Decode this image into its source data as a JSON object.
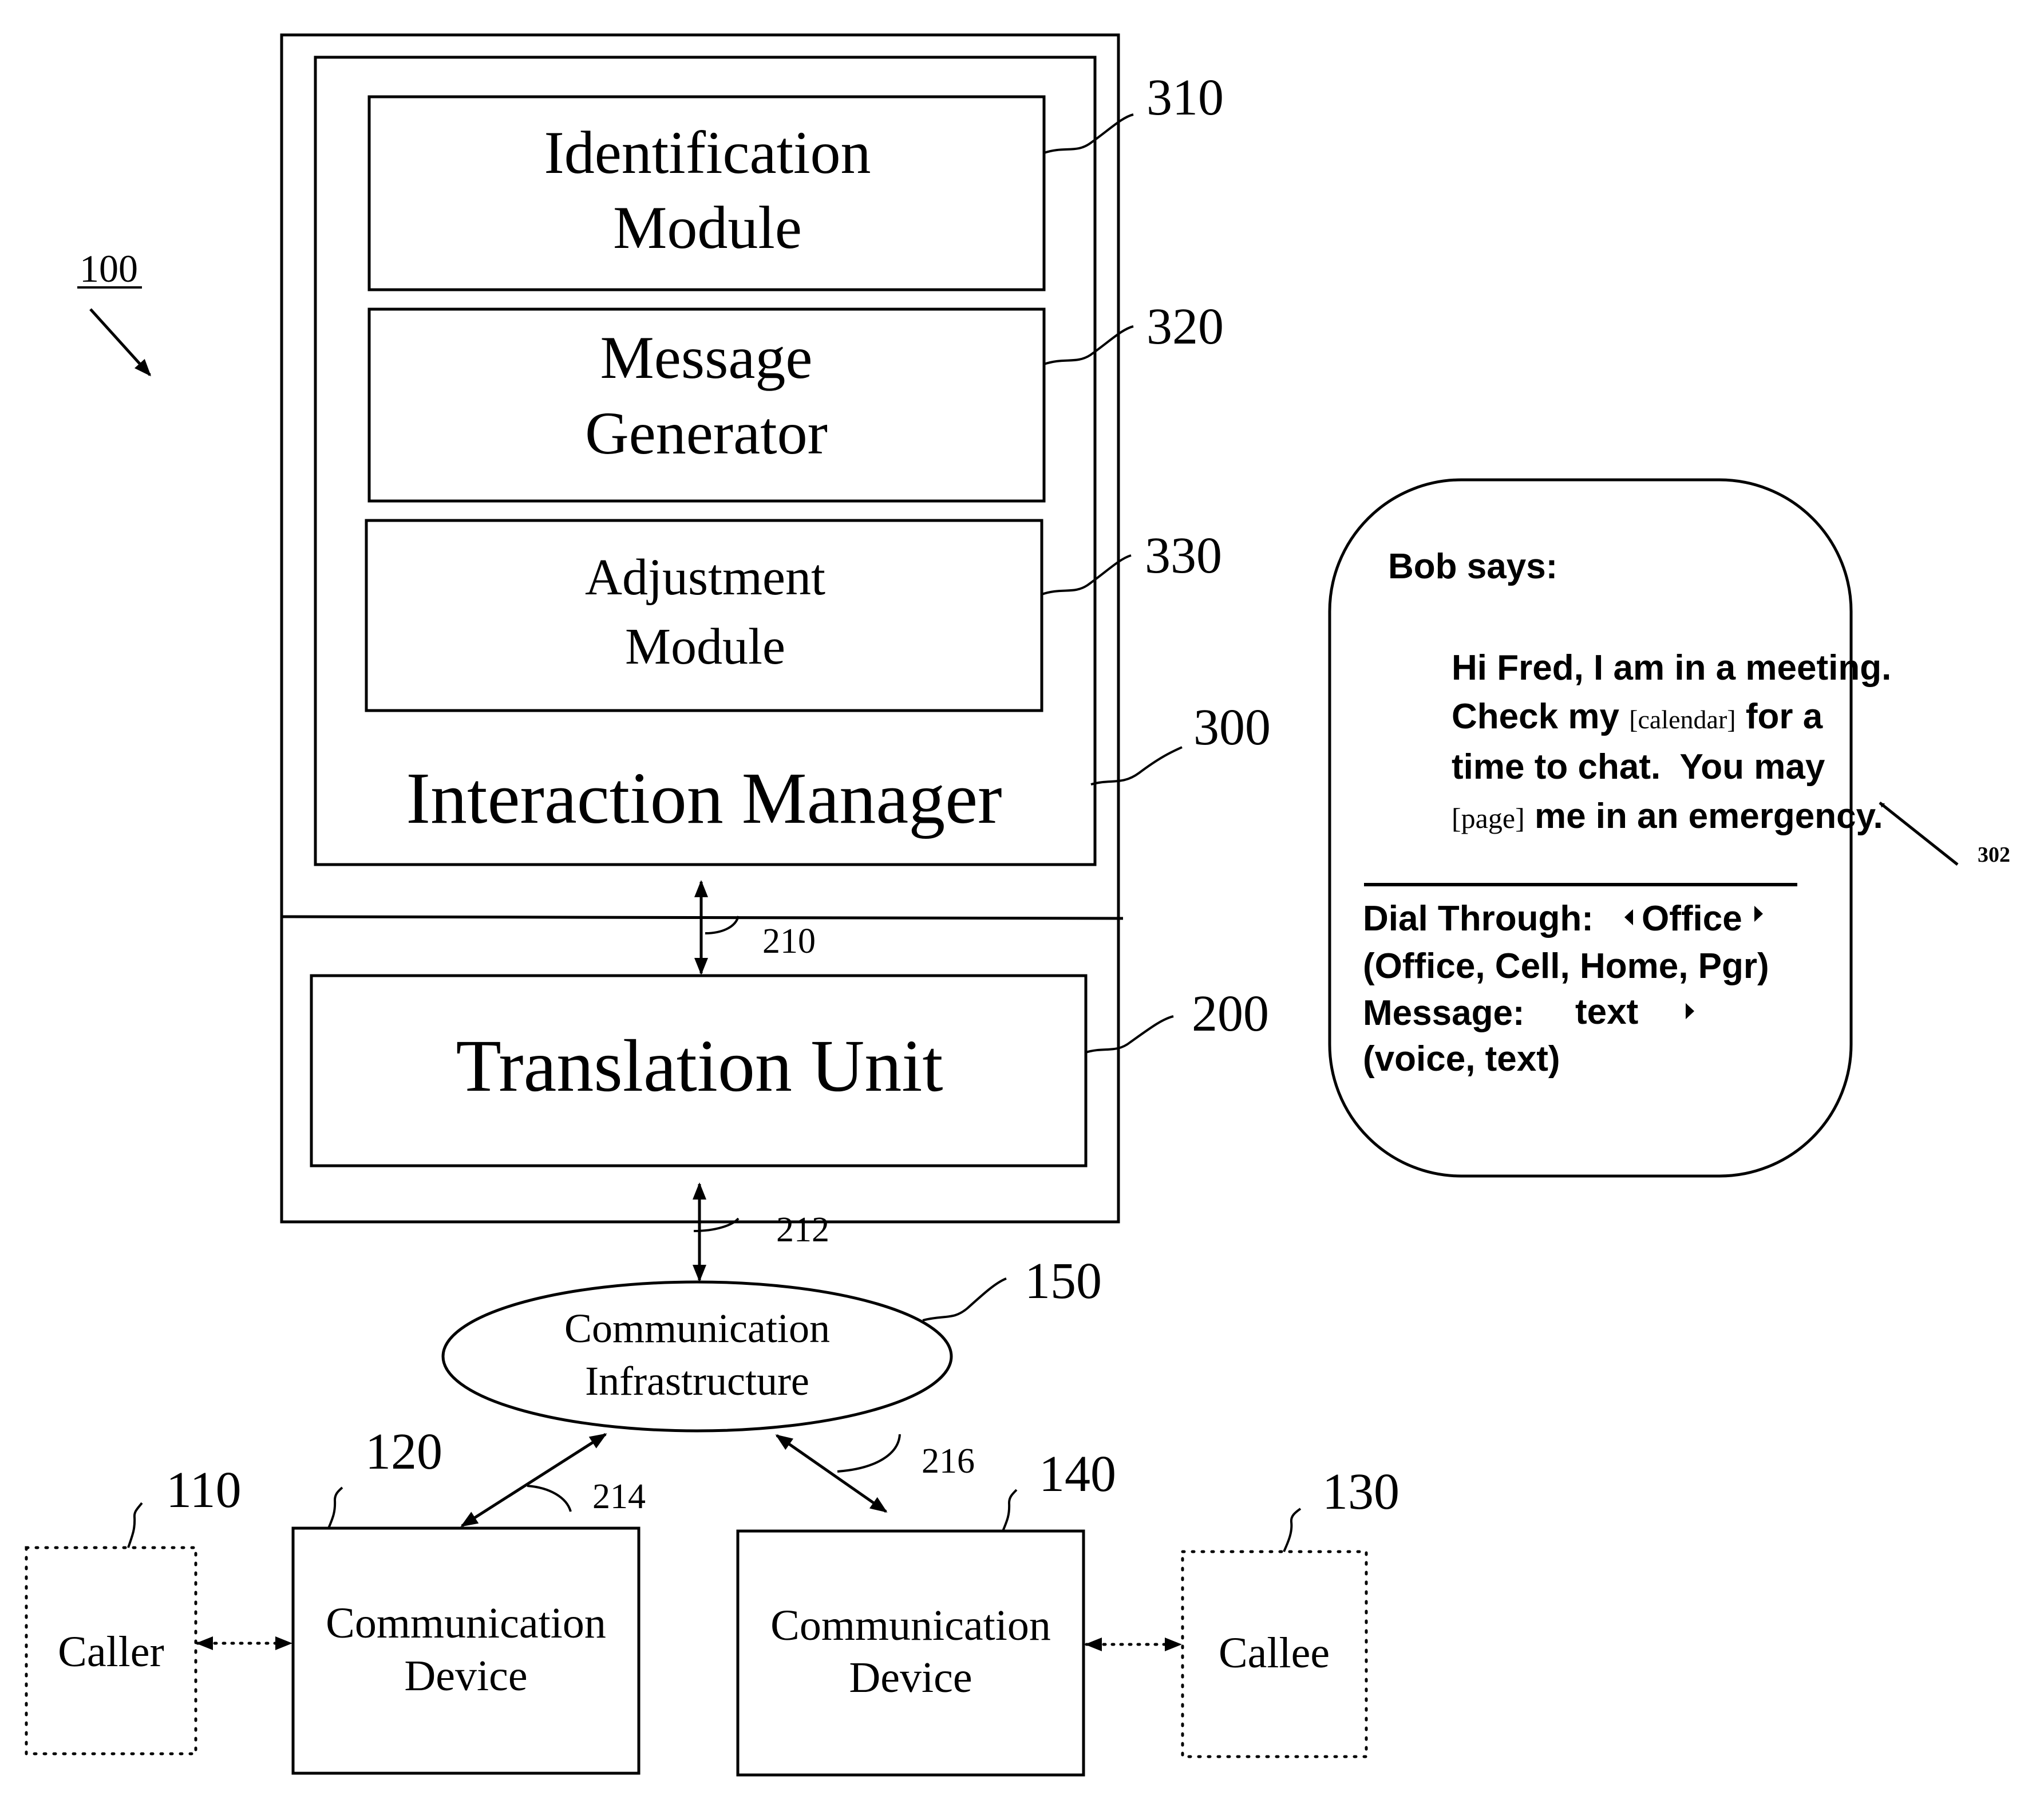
{
  "figure": {
    "system_label": "100",
    "interaction_manager": {
      "label": "Interaction Manager",
      "ref": "300",
      "modules": [
        {
          "lines": [
            "Identification",
            "Module"
          ],
          "ref": "310"
        },
        {
          "lines": [
            "Message",
            "Generator"
          ],
          "ref": "320"
        },
        {
          "lines": [
            "Adjustment",
            "Module"
          ],
          "ref": "330"
        }
      ]
    },
    "translation_unit": {
      "label": "Translation Unit",
      "ref": "200"
    },
    "links": {
      "im_tu": "210",
      "tu_infra": "212",
      "infra_dev1": "214",
      "infra_dev2": "216"
    },
    "infrastructure": {
      "lines": [
        "Communication",
        "Infrastructure"
      ],
      "ref": "150"
    },
    "caller": {
      "label": "Caller",
      "ref": "110"
    },
    "device1": {
      "lines": [
        "Communication",
        "Device"
      ],
      "ref": "120"
    },
    "device2": {
      "lines": [
        "Communication",
        "Device"
      ],
      "ref": "140"
    },
    "callee": {
      "label": "Callee",
      "ref": "130"
    },
    "message_display": {
      "ref": "302",
      "header": "Bob says:",
      "body_lines": [
        {
          "parts": [
            {
              "text": "Hi Fred, I am in a meeting.",
              "link": false
            }
          ]
        },
        {
          "parts": [
            {
              "text": "Check my ",
              "link": false
            },
            {
              "text": "[calendar]",
              "link": true
            },
            {
              "text": " for a",
              "link": false
            }
          ]
        },
        {
          "parts": [
            {
              "text": "time to chat.  You may",
              "link": false
            }
          ]
        },
        {
          "parts": [
            {
              "text": "[page]",
              "link": true
            },
            {
              "text": " me in an emergency.",
              "link": false
            }
          ]
        }
      ],
      "dial_through": {
        "label": "Dial Through:",
        "value": "Office",
        "options_text": "(Office, Cell, Home, Pgr)"
      },
      "message": {
        "label": "Message:",
        "value": "text",
        "options_text": "(voice, text)"
      }
    }
  }
}
